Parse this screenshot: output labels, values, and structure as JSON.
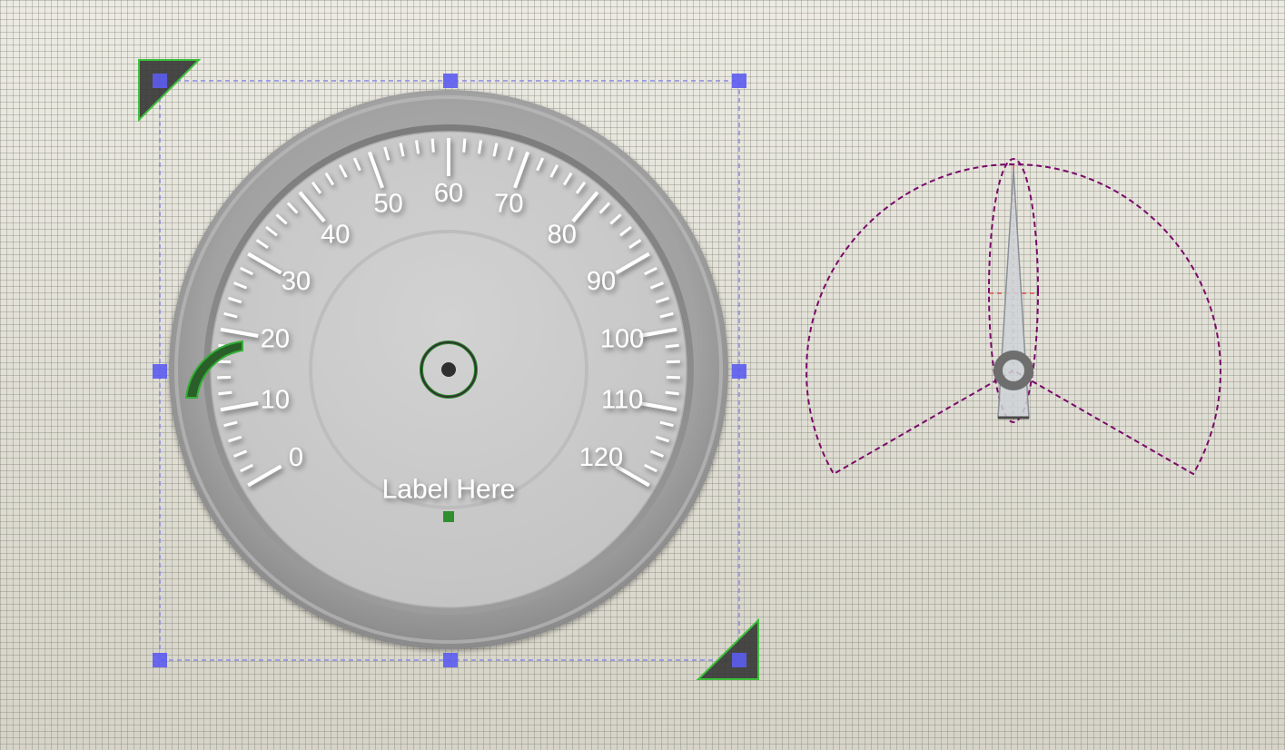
{
  "designer": {
    "canvas": "grid"
  },
  "gauge": {
    "label": "Label Here",
    "scale": {
      "min": 0,
      "max": 120,
      "major_step": 10,
      "minor_per_major": 5,
      "tick_labels": [
        "0",
        "10",
        "20",
        "30",
        "40",
        "50",
        "60",
        "70",
        "80",
        "90",
        "100",
        "110",
        "120"
      ]
    },
    "value": 0,
    "colors": {
      "bezel": "#9a9a9a",
      "face": "#cbcbcb",
      "ticks": "#ffffff",
      "accent": "#2f8f2f"
    }
  },
  "selection": {
    "handle_color": "#5c5cf0",
    "border_color": "#8a8ae6",
    "handles": [
      "top-left",
      "top-center",
      "top-right",
      "middle-left",
      "middle-right",
      "bottom-left",
      "bottom-center",
      "bottom-right"
    ]
  },
  "needle_preview": {
    "sweep_outline_color": "#7a0a6a",
    "guide_color": "#e05050",
    "hub_color": "#6e6e6e"
  },
  "icons": {
    "pivot": "pivot-target-icon",
    "arc_indicator": "arc-range-icon",
    "corner_resize": "corner-resize-icon"
  }
}
